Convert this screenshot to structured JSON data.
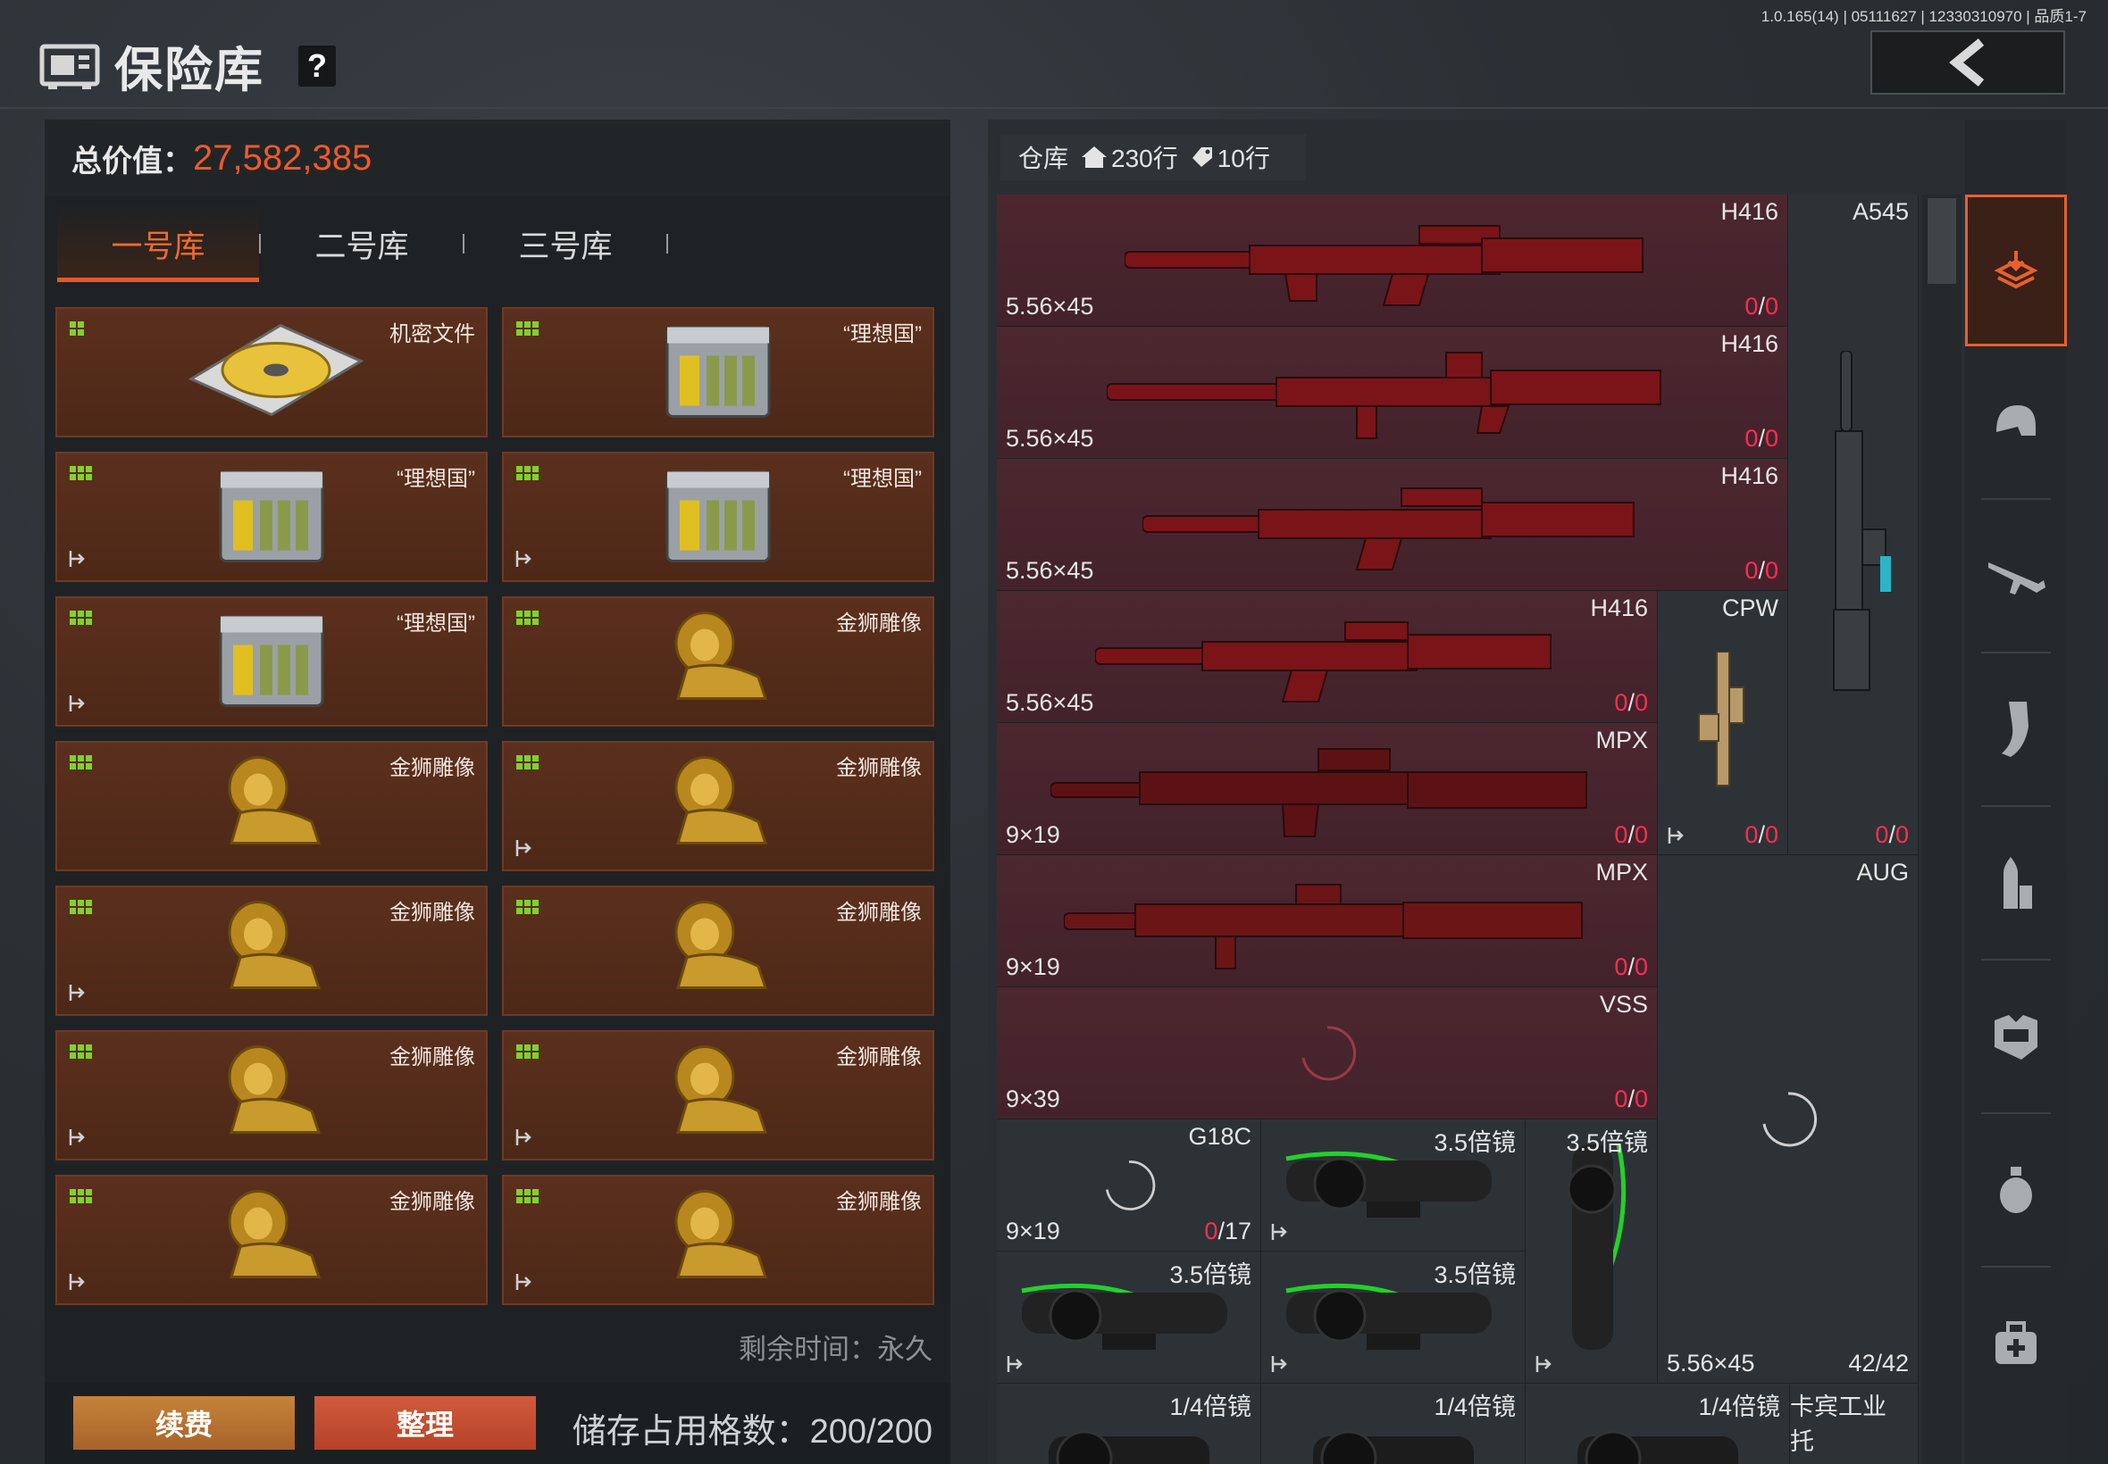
{
  "version": "1.0.165(14) | 05111627 | 12330310970 | 品质1-7",
  "header": {
    "title": "保险库",
    "help": "?"
  },
  "left": {
    "total_label": "总价值：",
    "total_value": "27,582,385",
    "tabs": [
      "一号库",
      "二号库",
      "三号库"
    ],
    "items": [
      {
        "name": "机密文件",
        "icon": "disk-icon",
        "exit": false
      },
      {
        "name": "“理想国”",
        "icon": "crate-icon",
        "exit": false
      },
      {
        "name": "“理想国”",
        "icon": "crate-icon",
        "exit": true
      },
      {
        "name": "“理想国”",
        "icon": "crate-icon",
        "exit": true
      },
      {
        "name": "“理想国”",
        "icon": "crate-icon",
        "exit": true
      },
      {
        "name": "金狮雕像",
        "icon": "lion-statue-icon",
        "exit": false
      },
      {
        "name": "金狮雕像",
        "icon": "lion-statue-icon",
        "exit": false
      },
      {
        "name": "金狮雕像",
        "icon": "lion-statue-icon",
        "exit": true
      },
      {
        "name": "金狮雕像",
        "icon": "lion-statue-icon",
        "exit": true
      },
      {
        "name": "金狮雕像",
        "icon": "lion-statue-icon",
        "exit": false
      },
      {
        "name": "金狮雕像",
        "icon": "lion-statue-icon",
        "exit": true
      },
      {
        "name": "金狮雕像",
        "icon": "lion-statue-icon",
        "exit": true
      },
      {
        "name": "金狮雕像",
        "icon": "lion-statue-icon",
        "exit": true
      },
      {
        "name": "金狮雕像",
        "icon": "lion-statue-icon",
        "exit": true
      }
    ],
    "remain_text": "剩余时间：永久",
    "renew_label": "续费",
    "sort_label": "整理",
    "storage_text": "储存占用格数：200/200"
  },
  "right": {
    "warehouse_label": "仓库",
    "rows_home": "230行",
    "rows_tag": "10行",
    "weapons": [
      {
        "name": "H416",
        "ammo": "5.56×45",
        "count_a": "0",
        "count_b": "0"
      },
      {
        "name": "H416",
        "ammo": "5.56×45",
        "count_a": "0",
        "count_b": "0"
      },
      {
        "name": "H416",
        "ammo": "5.56×45",
        "count_a": "0",
        "count_b": "0"
      },
      {
        "name": "H416",
        "ammo": "5.56×45",
        "count_a": "0",
        "count_b": "0"
      },
      {
        "name": "MPX",
        "ammo": "9×19",
        "count_a": "0",
        "count_b": "0"
      },
      {
        "name": "MPX",
        "ammo": "9×19",
        "count_a": "0",
        "count_b": "0"
      },
      {
        "name": "VSS",
        "ammo": "9×39",
        "count_a": "0",
        "count_b": "0"
      }
    ],
    "a545": {
      "name": "A545",
      "count_a": "0",
      "count_b": "0"
    },
    "cpw": {
      "name": "CPW",
      "count_a": "0",
      "count_b": "0"
    },
    "aug": {
      "name": "AUG",
      "ammo": "5.56×45",
      "count": "42/42"
    },
    "g18c": {
      "name": "G18C",
      "ammo": "9×19",
      "count_a": "0",
      "count_b": "/17"
    },
    "scopes": [
      "3.5倍镜",
      "3.5倍镜",
      "3.5倍镜",
      "3.5倍镜"
    ],
    "scopes_quarter": [
      "1/4倍镜",
      "1/4倍镜",
      "1/4倍镜"
    ],
    "stock": "卡宾工业托"
  },
  "sidebar": [
    "warehouse-icon",
    "helmet-icon",
    "rifle-icon",
    "magazine-icon",
    "ammo-icon",
    "vest-icon",
    "grenade-icon",
    "medkit-icon"
  ],
  "colors": {
    "accent": "#e6572a",
    "value": "#ee5a2b",
    "zero": "#ff2e55",
    "card": "#5b2f1d",
    "weapon_bg": "#4c2730"
  }
}
